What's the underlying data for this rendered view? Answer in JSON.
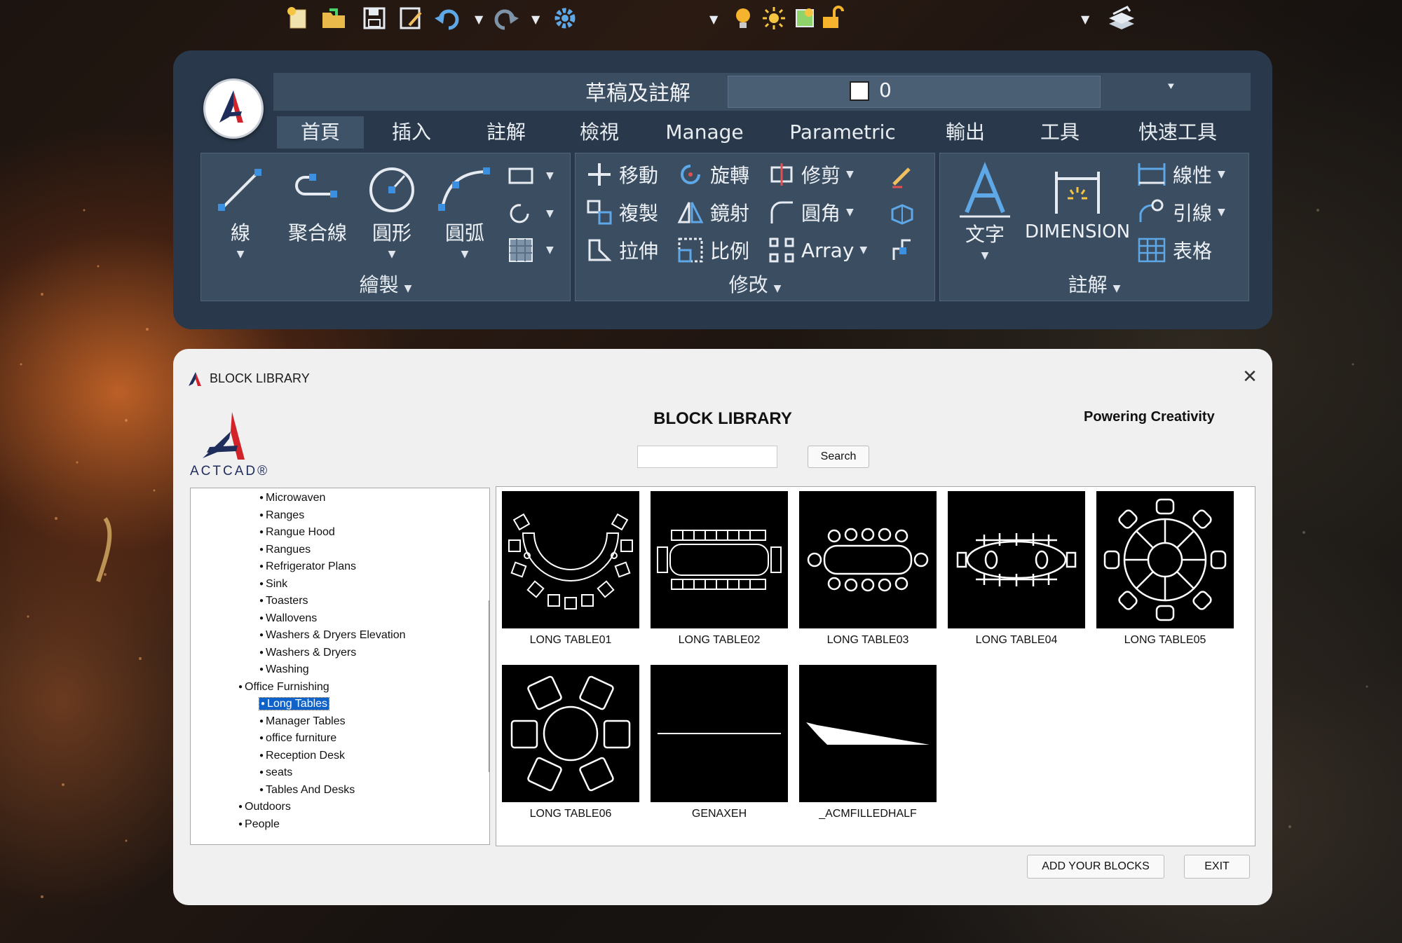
{
  "ribbon": {
    "workspace": "草稿及註解",
    "layer_name": "0",
    "tabs": [
      "首頁",
      "插入",
      "註解",
      "檢視",
      "Manage",
      "Parametric",
      "輸出",
      "工具",
      "快速工具"
    ],
    "panels": {
      "draw": {
        "title": "繪製",
        "tools": [
          "線",
          "聚合線",
          "圓形",
          "圓弧"
        ]
      },
      "modify": {
        "title": "修改",
        "rows": [
          [
            "移動",
            "旋轉",
            "修剪"
          ],
          [
            "複製",
            "鏡射",
            "圓角"
          ],
          [
            "拉伸",
            "比例",
            "Array"
          ]
        ]
      },
      "annotation": {
        "title": "註解",
        "text_tool": "文字",
        "dimension_tool": "DIMENSION",
        "small_tools": [
          "線性",
          "引線",
          "表格"
        ]
      }
    }
  },
  "dialog": {
    "title": "BLOCK LIBRARY",
    "heading": "BLOCK LIBRARY",
    "tagline": "Powering Creativity",
    "brand": "ACTCAD®",
    "search": {
      "value": "",
      "button": "Search"
    },
    "tree": [
      {
        "label": "Microwaven",
        "level": 2
      },
      {
        "label": "Ranges",
        "level": 2
      },
      {
        "label": "Rangue Hood",
        "level": 2
      },
      {
        "label": "Rangues",
        "level": 2
      },
      {
        "label": "Refrigerator Plans",
        "level": 2
      },
      {
        "label": "Sink",
        "level": 2
      },
      {
        "label": "Toasters",
        "level": 2
      },
      {
        "label": "Wallovens",
        "level": 2
      },
      {
        "label": "Washers & Dryers Elevation",
        "level": 2
      },
      {
        "label": "Washers & Dryers",
        "level": 2
      },
      {
        "label": "Washing",
        "level": 2
      },
      {
        "label": "Office Furnishing",
        "level": 1
      },
      {
        "label": "Long Tables",
        "level": 2,
        "selected": true
      },
      {
        "label": "Manager Tables",
        "level": 2
      },
      {
        "label": "office furniture",
        "level": 2
      },
      {
        "label": "Reception Desk",
        "level": 2
      },
      {
        "label": "seats",
        "level": 2
      },
      {
        "label": "Tables And Desks",
        "level": 2
      },
      {
        "label": "Outdoors",
        "level": 1
      },
      {
        "label": "People",
        "level": 1
      }
    ],
    "blocks": [
      "LONG TABLE01",
      "LONG TABLE02",
      "LONG TABLE03",
      "LONG TABLE04",
      "LONG TABLE05",
      "LONG TABLE06",
      "GENAXEH",
      "_ACMFILLEDHALF"
    ],
    "buttons": {
      "add": "ADD YOUR BLOCKS",
      "exit": "EXIT"
    }
  },
  "colors": {
    "ribbon_bg": "#29394b",
    "panel_bg": "#3b4d61",
    "selection": "#0f62c9",
    "logo_red": "#d2232a",
    "logo_navy": "#1f2d5c"
  }
}
